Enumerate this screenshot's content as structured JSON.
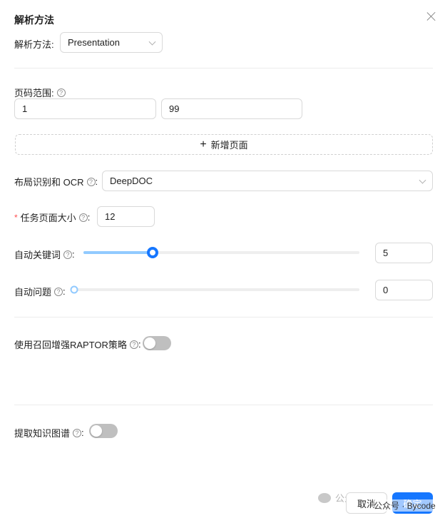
{
  "dialog": {
    "title": "解析方法",
    "close_icon": "close-icon"
  },
  "parse_method": {
    "label": "解析方法:",
    "value": "Presentation"
  },
  "page_range": {
    "label": "页码范围:",
    "start": "1",
    "end": "99",
    "add_label": "新增页面"
  },
  "layout_ocr": {
    "label": "布局识别和 OCR",
    "value": "DeepDOC"
  },
  "task_page_size": {
    "label": "任务页面大小",
    "value": "12"
  },
  "auto_keywords": {
    "label": "自动关键词",
    "value": "5",
    "fraction": 0.25
  },
  "auto_questions": {
    "label": "自动问题",
    "value": "0",
    "fraction": 0.0
  },
  "raptor": {
    "label": "使用召回增强RAPTOR策略",
    "enabled": false
  },
  "knowledge_graph": {
    "label": "提取知识图谱",
    "enabled": false
  },
  "footer": {
    "cancel_label": "取消",
    "ok_label": "确定",
    "watermark": "公众号",
    "watermark2": "公众号 · Bycode"
  },
  "colors": {
    "primary": "#1677ff",
    "slider_fill": "#91caff",
    "required": "#ff4d4f"
  }
}
